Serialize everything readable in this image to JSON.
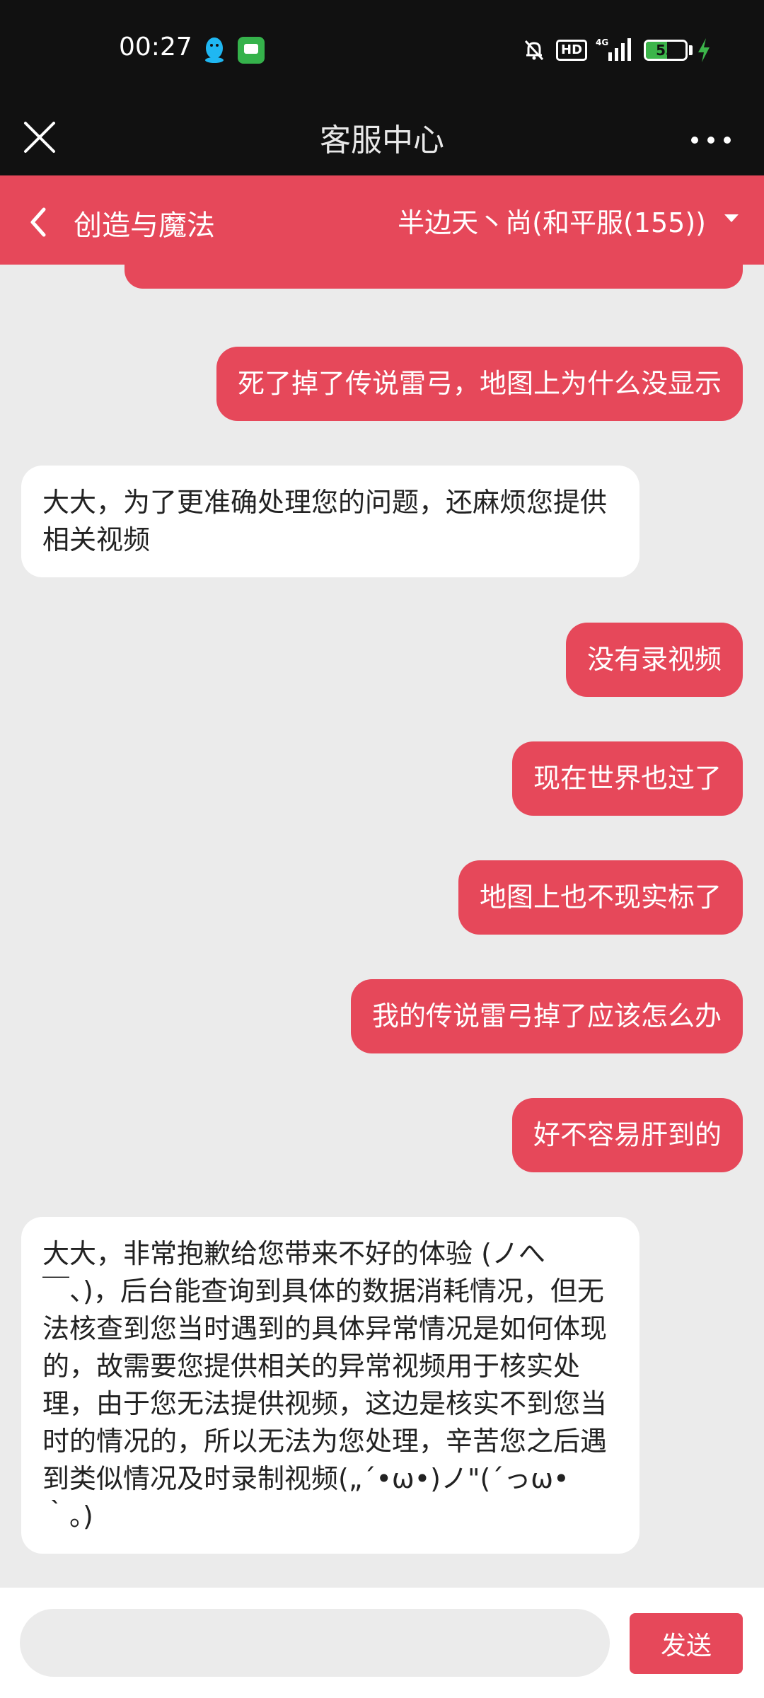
{
  "status_bar": {
    "time": "00:27",
    "hd_label": "HD",
    "network_label": "4G",
    "battery_level": 53,
    "battery_text": "53",
    "icons": [
      "qq-icon",
      "message-icon",
      "mute-icon",
      "signal-icon",
      "battery-icon",
      "charging-icon"
    ]
  },
  "header": {
    "title": "客服中心",
    "close_icon": "close-icon",
    "more_icon": "more-icon"
  },
  "game_bar": {
    "game_name": "创造与魔法",
    "server": "半边天丶尚(和平服(155))",
    "back_icon": "chevron-left-icon",
    "dropdown_icon": "triangle-down-icon"
  },
  "messages": [
    {
      "side": "out",
      "text": "死了掉了传说雷弓，地图上为什么没显示"
    },
    {
      "side": "in",
      "text": "大大，为了更准确处理您的问题，还麻烦您提供相关视频"
    },
    {
      "side": "out",
      "text": "没有录视频"
    },
    {
      "side": "out",
      "text": "现在世界也过了"
    },
    {
      "side": "out",
      "text": "地图上也不现实标了"
    },
    {
      "side": "out",
      "text": "我的传说雷弓掉了应该怎么办"
    },
    {
      "side": "out",
      "text": "好不容易肝到的"
    },
    {
      "side": "in",
      "text": "大大，非常抱歉给您带来不好的体验 (ノへ￣、)，后台能查询到具体的数据消耗情况，但无法核查到您当时遇到的具体异常情况是如何体现的，故需要您提供相关的异常视频用于核实处理，由于您无法提供视频，这边是核实不到您当时的情况的，所以无法为您处理，辛苦您之后遇到类似情况及时录制视频(„´•ω•)ノ\"(´っω•｀。)"
    }
  ],
  "input": {
    "placeholder": "",
    "value": "",
    "send_label": "发送"
  },
  "colors": {
    "accent": "#e6485a",
    "chat_background": "#ebebeb",
    "bar_dark": "#111111",
    "battery_green": "#3cb54a"
  }
}
